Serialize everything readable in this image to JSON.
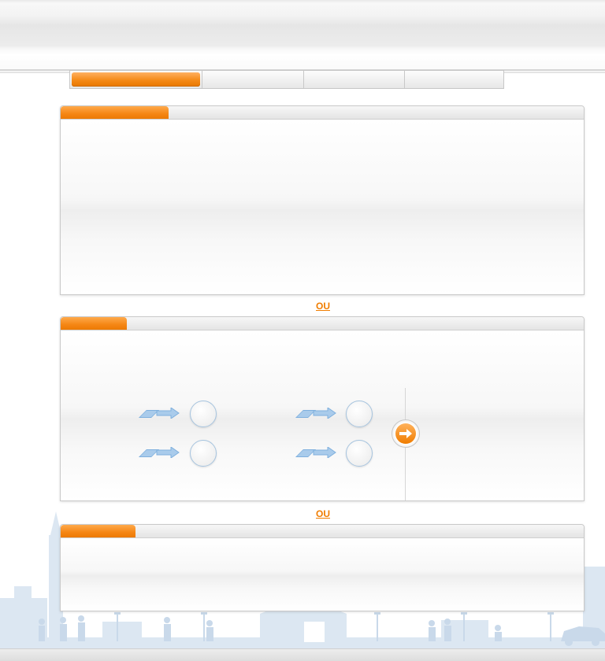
{
  "navigation": {
    "tabs": [
      {
        "label": "",
        "active": true
      },
      {
        "label": "",
        "active": false
      },
      {
        "label": "",
        "active": false
      },
      {
        "label": "",
        "active": false
      }
    ]
  },
  "separators": {
    "first": "OU",
    "second": "OU"
  },
  "panels": [
    {
      "title": ""
    },
    {
      "title": ""
    },
    {
      "title": ""
    }
  ],
  "colors": {
    "accent": "#f58614",
    "accent_text": "#f07d00",
    "icon_blue": "#a9cbeb",
    "city_silhouette": "#dce7f2"
  },
  "icons": {
    "go_button": "arrow-right-icon",
    "step_arrow": "double-arrow-icon"
  }
}
